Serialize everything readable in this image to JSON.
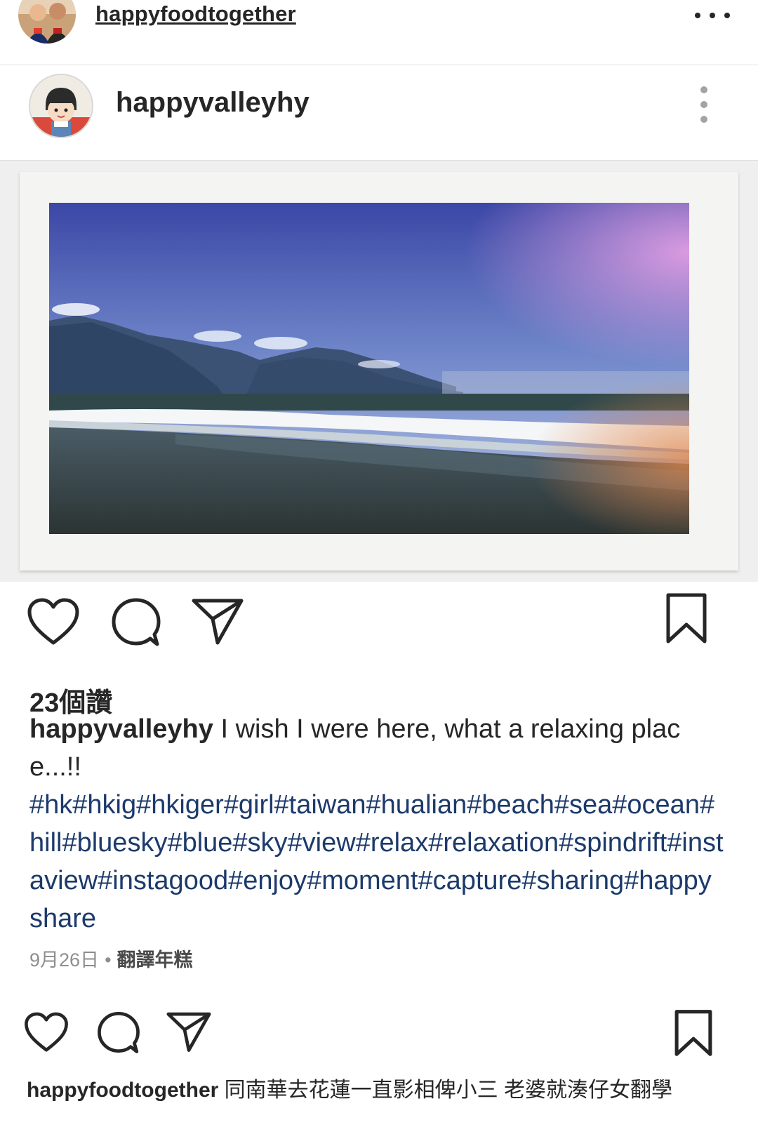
{
  "outer_post": {
    "username": "happyfoodtogether",
    "more_icon": "more-horizontal-icon",
    "caption_user": "happyfoodtogether",
    "caption_text": "同南華去花蓮一直影相俾小三 老婆就湊仔女翻學"
  },
  "inner_post": {
    "username": "happyvalleyhy",
    "more_icon": "more-vertical-icon",
    "likes": "23個讚",
    "caption_user": "happyvalleyhy",
    "caption_text": "I wish I were here, what a relaxing place...!!",
    "hashtags": "#hk#hkig#hkiger#girl#taiwan#hualian#beach#sea#ocean#hill#bluesky#blue#sky#view#relax#relaxation#spindrift#instaview#instagood#enjoy#moment#capture#sharing#happyshare",
    "date": "9月26日",
    "separator": "•",
    "translate": "翻譯年糕"
  },
  "icons": {
    "like": "heart-icon",
    "comment": "comment-bubble-icon",
    "share": "paper-plane-icon",
    "save": "bookmark-icon"
  },
  "colors": {
    "text": "#262626",
    "hashtag": "#1c3a6b",
    "muted": "#8e8e8e",
    "divider": "#e0e0e0"
  }
}
